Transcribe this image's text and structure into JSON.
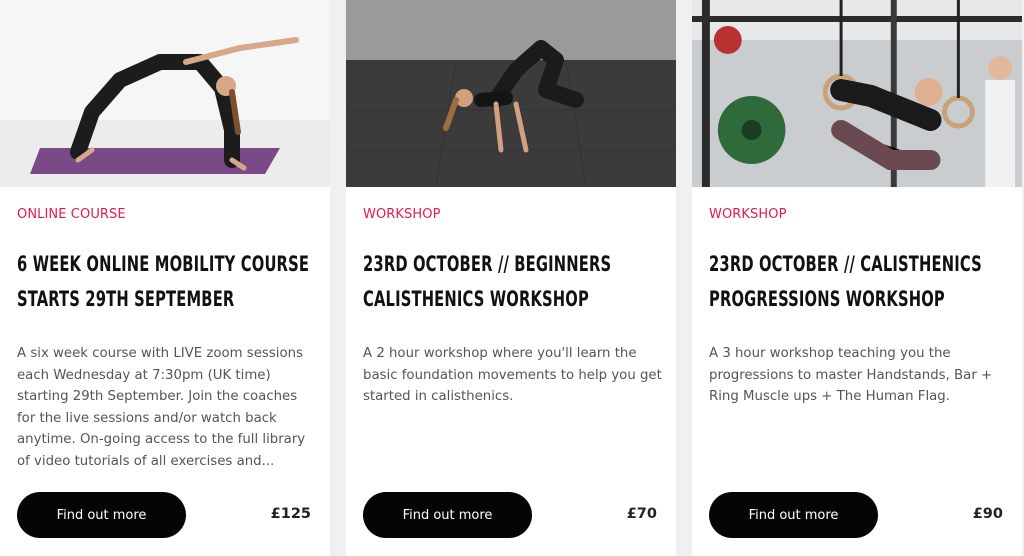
{
  "colors": {
    "page_background": "#f0f0f2",
    "card_background": "#ffffff",
    "category_accent": "#e6194b",
    "button_background": "#050505",
    "button_text": "#ffffff"
  },
  "cards": [
    {
      "image_icon": "yoga-wheel-pose-photo",
      "category": "ONLINE COURSE",
      "title": "6 WEEK ONLINE MOBILITY COURSE STARTS 29TH SEPTEMBER",
      "description": "A six week course with LIVE zoom sessions each Wednesday at 7:30pm (UK time) starting 29th September. Join the coaches for the live sessions and/or watch back anytime. On-going access to the full library of video tutorials of all exercises and...",
      "button_label": "Find out more",
      "price": "£125"
    },
    {
      "image_icon": "crow-pose-photo",
      "category": "WORKSHOP",
      "title": "23RD OCTOBER // BEGINNERS CALISTHENICS WORKSHOP",
      "description": "A 2 hour workshop where you'll learn the basic foundation movements to help you get started in calisthenics.",
      "button_label": "Find out more",
      "price": "£70"
    },
    {
      "image_icon": "ring-muscle-up-photo",
      "category": "WORKSHOP",
      "title": "23RD OCTOBER // CALISTHENICS PROGRESSIONS WORKSHOP",
      "description": "A 3 hour workshop teaching you the progressions to master Handstands, Bar + Ring Muscle ups + The Human Flag.",
      "button_label": "Find out more",
      "price": "£90"
    }
  ]
}
